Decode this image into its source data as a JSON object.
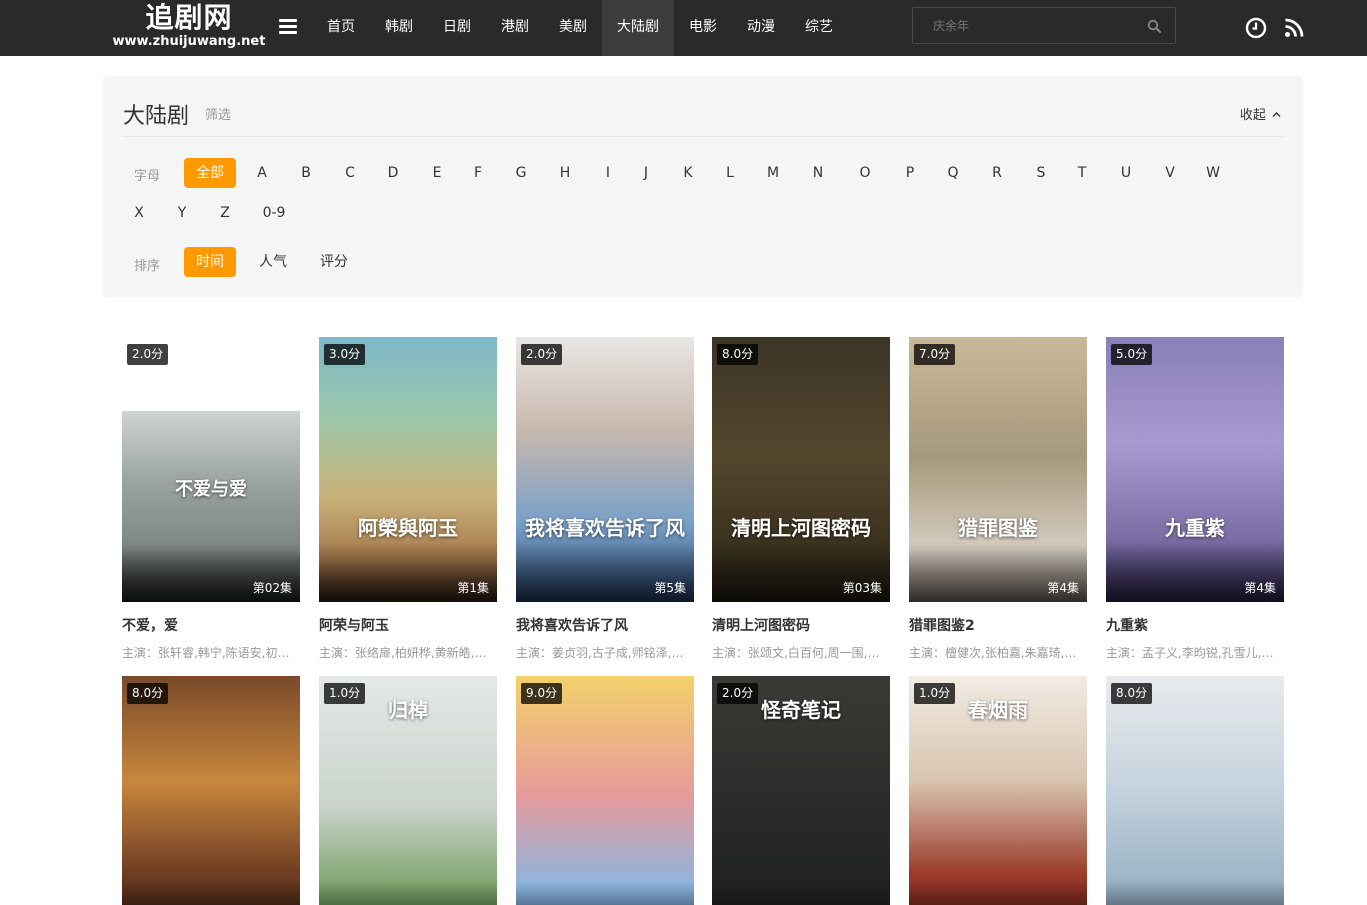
{
  "header": {
    "logo_title": "追剧网",
    "logo_url": "www.zhuijuwang.net",
    "nav": [
      "首页",
      "韩剧",
      "日剧",
      "港剧",
      "美剧",
      "大陆剧",
      "电影",
      "动漫",
      "综艺"
    ],
    "nav_active_index": 5,
    "search_placeholder": "庆余年"
  },
  "filter": {
    "title": "大陆剧",
    "subtitle": "筛选",
    "collapse_label": "收起",
    "letter_label": "字母",
    "letters": [
      "全部",
      "A",
      "B",
      "C",
      "D",
      "E",
      "F",
      "G",
      "H",
      "I",
      "J",
      "K",
      "L",
      "M",
      "N",
      "O",
      "P",
      "Q",
      "R",
      "S",
      "T",
      "U",
      "V",
      "W",
      "X",
      "Y",
      "Z",
      "0-9"
    ],
    "sort_label": "排序",
    "sorts": [
      "时间",
      "人气",
      "评分"
    ]
  },
  "colors": {
    "accent": "#ff9900",
    "header_bg": "#2a2a2a"
  },
  "cards": [
    {
      "title": "不爱，爱",
      "cast": "主演：张轩睿,韩宁,陈语安,初孟...",
      "score": "2.0分",
      "episode": "第02集",
      "poster_text": "不爱与爱"
    },
    {
      "title": "阿荣与阿玉",
      "cast": "主演：张络扉,柏妍桦,黄新皓,何...",
      "score": "3.0分",
      "episode": "第1集",
      "poster_text": "阿榮與阿玉"
    },
    {
      "title": "我将喜欢告诉了风",
      "cast": "主演：姜贞羽,古子成,师铭泽,陈...",
      "score": "2.0分",
      "episode": "第5集",
      "poster_text": "我将喜欢告诉了风"
    },
    {
      "title": "清明上河图密码",
      "cast": "主演：张颂文,白百何,周一围,侯...",
      "score": "8.0分",
      "episode": "第03集",
      "poster_text": "清明上河图密码"
    },
    {
      "title": "猎罪图鉴2",
      "cast": "主演：檀健次,张柏嘉,朱嘉琦,陆...",
      "score": "7.0分",
      "episode": "第4集",
      "poster_text": "猎罪图鉴"
    },
    {
      "title": "九重紫",
      "cast": "主演：孟子义,李昀锐,孔雪儿,夏...",
      "score": "5.0分",
      "episode": "第4集",
      "poster_text": "九重紫"
    },
    {
      "title": "",
      "cast": "",
      "score": "8.0分",
      "episode": "",
      "poster_text": ""
    },
    {
      "title": "",
      "cast": "",
      "score": "1.0分",
      "episode": "",
      "poster_text": "归棹"
    },
    {
      "title": "",
      "cast": "",
      "score": "9.0分",
      "episode": "",
      "poster_text": ""
    },
    {
      "title": "",
      "cast": "",
      "score": "2.0分",
      "episode": "",
      "poster_text": "怪奇笔记"
    },
    {
      "title": "",
      "cast": "",
      "score": "1.0分",
      "episode": "",
      "poster_text": "春烟雨"
    },
    {
      "title": "",
      "cast": "",
      "score": "8.0分",
      "episode": "",
      "poster_text": ""
    }
  ]
}
